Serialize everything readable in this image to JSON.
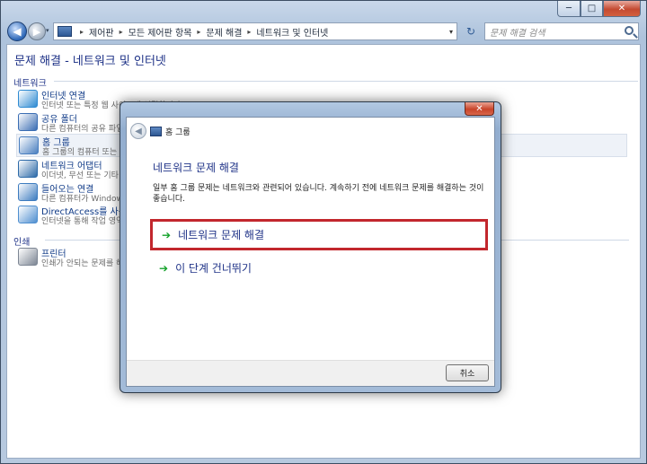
{
  "window": {
    "controls": {
      "minimize": "─",
      "maximize": "□",
      "close": "✕"
    }
  },
  "nav": {
    "back": "◀",
    "forward": "▶",
    "dropdown": "▾",
    "refresh": "↻",
    "breadcrumbs": [
      "제어판",
      "모든 제어판 항목",
      "문제 해결",
      "네트워크 및 인터넷"
    ],
    "search_placeholder": "문제 해결 검색"
  },
  "page": {
    "title": "문제 해결 - 네트워크 및 인터넷",
    "sections": [
      {
        "label": "네트워크",
        "items": [
          {
            "title": "인터넷 연결",
            "desc": "인터넷 또는 특정 웹 사이트에 연결합니다.",
            "icon": "internet-icon",
            "color": "#2f8bd2"
          },
          {
            "title": "공유 폴더",
            "desc": "다른 컴퓨터의 공유 파일 및 폴더에 액세스합니다.",
            "icon": "shared-folder-icon",
            "color": "#3a6db3"
          },
          {
            "title": "홈 그룹",
            "desc": "홈 그룹의 컴퓨터 또는 공유 파일을 봅니다.",
            "icon": "homegroup-icon",
            "color": "#4a7fc0"
          },
          {
            "title": "네트워크 어댑터",
            "desc": "이더넷, 무선 또는 기타 네트워크 어댑터를 구성합니다.",
            "icon": "network-adapter-icon",
            "color": "#2d6aa8"
          },
          {
            "title": "들어오는 연결",
            "desc": "다른 컴퓨터가 Windows를 실행하는 이 컴퓨터에 연결하도록 허용합니다.",
            "icon": "incoming-connections-icon",
            "color": "#3c7bbf"
          },
          {
            "title": "DirectAccess를 사용하여 작업 공간에 연결",
            "desc": "인터넷을 통해 작업 영역 네트워크에 연결합니다.",
            "icon": "directaccess-icon",
            "color": "#4f8fd0"
          }
        ]
      },
      {
        "label": "인쇄",
        "items": [
          {
            "title": "프린터",
            "desc": "인쇄가 안되는 문제를 해결합니다.",
            "icon": "printer-icon",
            "color": "#7d8694"
          }
        ]
      }
    ]
  },
  "dialog": {
    "close": "✕",
    "back": "◀",
    "title": "홈 그룹",
    "heading": "네트워크 문제 해결",
    "text": "일부 홈 그룹 문제는 네트워크와 관련되어 있습니다. 계속하기 전에 네트워크 문제를 해결하는 것이 좋습니다.",
    "actions": [
      {
        "arrow": "➔",
        "label": "네트워크 문제 해결"
      },
      {
        "arrow": "➔",
        "label": "이 단계 건너뛰기"
      }
    ],
    "cancel_label": "취소"
  }
}
